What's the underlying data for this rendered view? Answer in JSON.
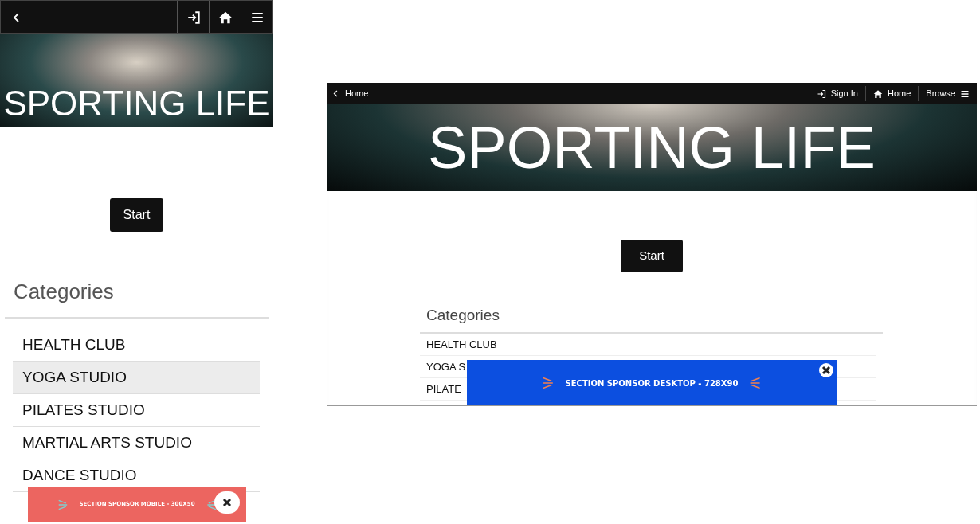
{
  "mobile": {
    "hero": {
      "title": "SPORTING LIFE"
    },
    "start_button": "Start",
    "categories": {
      "heading": "Categories",
      "items": [
        {
          "label": "HEALTH CLUB",
          "selected": false
        },
        {
          "label": "YOGA STUDIO",
          "selected": true
        },
        {
          "label": "PILATES STUDIO",
          "selected": false
        },
        {
          "label": "MARTIAL ARTS STUDIO",
          "selected": false
        },
        {
          "label": "DANCE STUDIO",
          "selected": false
        }
      ]
    },
    "ad": {
      "kind": "mobile",
      "text": "SECTION SPONSOR MOBILE - 300X50"
    }
  },
  "desktop": {
    "nav": {
      "back": "Home",
      "sign_in": "Sign In",
      "home": "Home",
      "browse": "Browse"
    },
    "hero": {
      "title": "SPORTING LIFE"
    },
    "start_button": "Start",
    "categories": {
      "heading": "Categories",
      "items": [
        {
          "label": "HEALTH CLUB",
          "selected": false
        },
        {
          "label": "YOGA S",
          "selected": false
        },
        {
          "label": "PILATE",
          "selected": false
        }
      ]
    },
    "ad": {
      "kind": "desktop",
      "text": "SECTION SPONSOR DESKTOP - 728X90"
    }
  }
}
